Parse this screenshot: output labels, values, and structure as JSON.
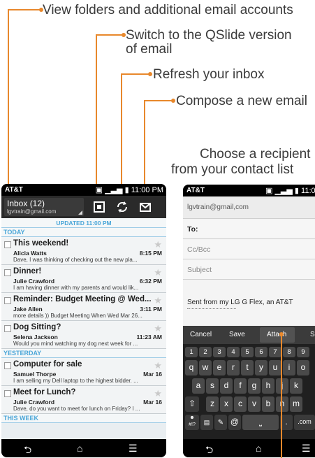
{
  "callouts": {
    "folders": "View folders and additional email accounts",
    "qslide_line1": "Switch to the QSlide version",
    "qslide_line2": "of email",
    "refresh": "Refresh your inbox",
    "compose": "Compose a new email",
    "recipient_line1": "Choose a recipient",
    "recipient_line2": "from your contact list"
  },
  "colors": {
    "callout": "#e8882c",
    "accent": "#4aa6d8"
  },
  "inbox_phone": {
    "carrier": "AT&T",
    "time": "11:00 PM",
    "folder_title": "Inbox (12)",
    "account": "lgvtrain@gmail.com",
    "updated": "UPDATED 11:00 PM",
    "icons": {
      "qslide": "qslide-icon",
      "refresh": "refresh-icon",
      "compose": "compose-icon"
    },
    "sections": {
      "today": "TODAY",
      "yesterday": "YESTERDAY",
      "this_week": "THIS WEEK"
    },
    "messages": [
      {
        "subject": "This weekend!",
        "from": "Alicia Watts",
        "time": "8:15 PM",
        "preview": "Dave, I was thinking of checking out the new pla..."
      },
      {
        "subject": "Dinner!",
        "from": "Julie Crawford",
        "time": "6:32 PM",
        "preview": "I am having dinner with my parents and would lik..."
      },
      {
        "subject": "Reminder: Budget Meeting @ Wed...",
        "from": "Jake Allen",
        "time": "3:11 PM",
        "preview": "more details )) Budget Meeting When Wed Mar 26..."
      },
      {
        "subject": "Dog Sitting?",
        "from": "Selena Jackson",
        "time": "11:23 AM",
        "preview": "Would you mind watching my dog next week for ..."
      },
      {
        "subject": "Computer for sale",
        "from": "Samuel Thorpe",
        "time": "Mar 16",
        "preview": "I am selling my Dell laptop to the highest bidder. ..."
      },
      {
        "subject": "Meet for Lunch?",
        "from": "Julie Crawford",
        "time": "Mar 16",
        "preview": "Dave, do you want to meet for lunch on Friday? I ..."
      }
    ]
  },
  "compose_phone": {
    "carrier": "AT&T",
    "time": "11:0",
    "account": "lgvtrain@gmail,com",
    "to_label": "To:",
    "cc_label": "Cc/Bcc",
    "subject_label": "Subject",
    "signature": "Sent from my LG G Flex, an AT&T",
    "actions": {
      "cancel": "Cancel",
      "save": "Save",
      "attach": "Attach",
      "send": "S"
    },
    "keyboard": {
      "numbers": [
        "1",
        "2",
        "3",
        "4",
        "5",
        "6",
        "7",
        "8",
        "9"
      ],
      "row1": [
        "q",
        "w",
        "e",
        "r",
        "t",
        "y",
        "u",
        "i",
        "o"
      ],
      "row2": [
        "a",
        "s",
        "d",
        "f",
        "g",
        "h",
        "j",
        "k"
      ],
      "row3": [
        "z",
        "x",
        "c",
        "v",
        "b",
        "n",
        "m"
      ],
      "shift": "⇧",
      "sym": "#!?",
      "at": "@",
      "com": ".com"
    }
  }
}
